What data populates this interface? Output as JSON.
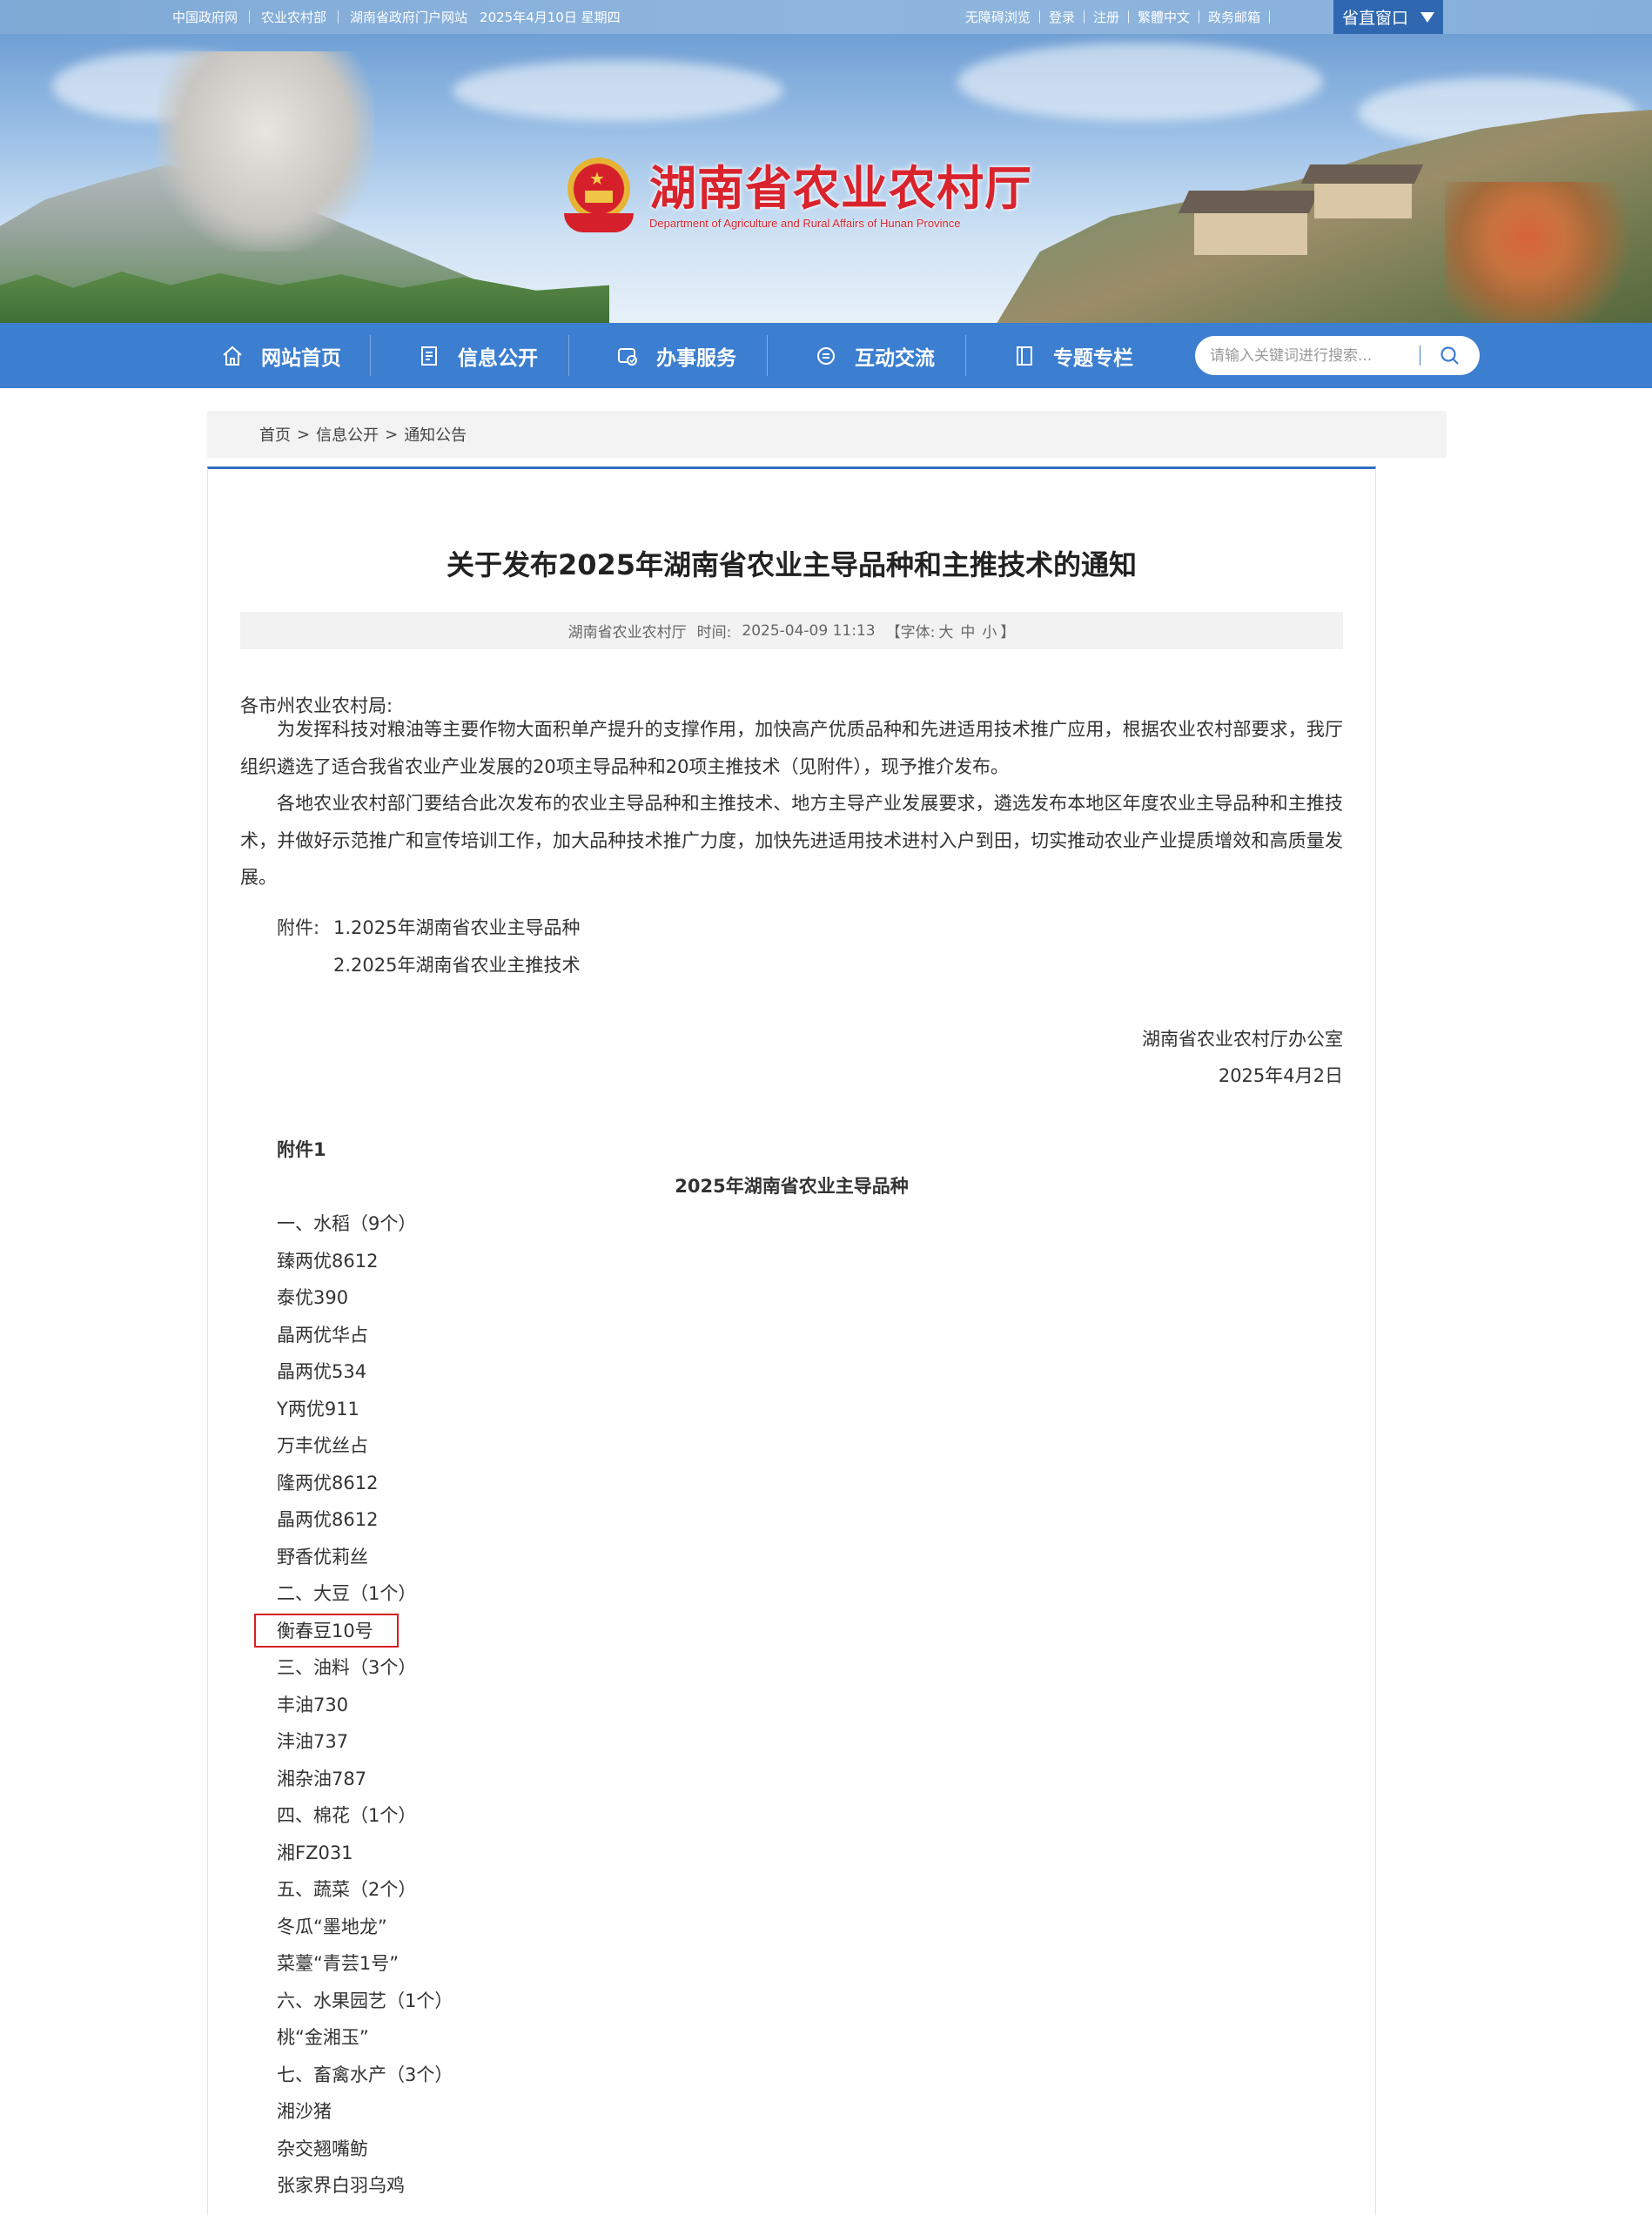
{
  "topbar": {
    "links_left": [
      "中国政府网",
      "农业农村部",
      "湖南省政府门户网站"
    ],
    "date": "2025年4月10日 星期四",
    "links_right": [
      "无障碍浏览",
      "登录",
      "注册",
      "繁體中文",
      "政务邮箱"
    ],
    "portal_label": "省直窗口"
  },
  "logo": {
    "title_cn": "湖南省农业农村厅",
    "title_en": "Department of Agriculture and Rural Affairs of Hunan Province"
  },
  "nav": {
    "items": [
      {
        "label": "网站首页",
        "icon": "home-icon"
      },
      {
        "label": "信息公开",
        "icon": "document-icon"
      },
      {
        "label": "办事服务",
        "icon": "service-icon"
      },
      {
        "label": "互动交流",
        "icon": "chat-icon"
      },
      {
        "label": "专题专栏",
        "icon": "bookmark-icon"
      }
    ],
    "search_placeholder": "请输入关键词进行搜索..."
  },
  "breadcrumb": [
    "首页",
    "信息公开",
    "通知公告"
  ],
  "article": {
    "title": "关于发布2025年湖南省农业主导品种和主推技术的通知",
    "source": "湖南省农业农村厅",
    "time_label": "时间:",
    "time": "2025-04-09 11:13",
    "font_label": "【字体:",
    "font_sizes": [
      "大",
      "中",
      "小"
    ],
    "font_close": "】",
    "greeting": "各市州农业农村局:",
    "paragraphs": [
      "为发挥科技对粮油等主要作物大面积单产提升的支撑作用，加快高产优质品种和先进适用技术推广应用，根据农业农村部要求，我厅组织遴选了适合我省农业产业发展的20项主导品种和20项主推技术（见附件），现予推介发布。",
      "各地农业农村部门要结合此次发布的农业主导品种和主推技术、地方主导产业发展要求，遴选发布本地区年度农业主导品种和主推技术，并做好示范推广和宣传培训工作，加大品种技术推广力度，加快先进适用技术进村入户到田，切实推动农业产业提质增效和高质量发展。"
    ],
    "attachment_label": "附件:",
    "attachments": [
      "1.2025年湖南省农业主导品种",
      "2.2025年湖南省农业主推技术"
    ],
    "signature": "湖南省农业农村厅办公室",
    "sign_date": "2025年4月2日",
    "annex_title": "附件1",
    "annex_heading": "2025年湖南省农业主导品种",
    "list": [
      "一、水稻（9个）",
      "臻两优8612",
      "泰优390",
      "晶两优华占",
      "晶两优534",
      "Y两优911",
      "万丰优丝占",
      "隆两优8612",
      "晶两优8612",
      "野香优莉丝",
      "二、大豆（1个）",
      "衡春豆10号",
      "三、油料（3个）",
      "丰油730",
      "沣油737",
      "湘杂油787",
      "四、棉花（1个）",
      "湘FZ031",
      "五、蔬菜（2个）",
      "冬瓜“墨地龙”",
      "菜薹“青芸1号”",
      "六、水果园艺（1个）",
      "桃“金湘玉”",
      "七、畜禽水产（3个）",
      "湘沙猪",
      "杂交翘嘴鲂",
      "张家界白羽乌鸡"
    ]
  },
  "colors": {
    "nav_bg": "#3c7ed0",
    "portal_bg": "#2f67b1",
    "logo_red": "#d9232d",
    "highlight_red": "#d81e1e"
  }
}
